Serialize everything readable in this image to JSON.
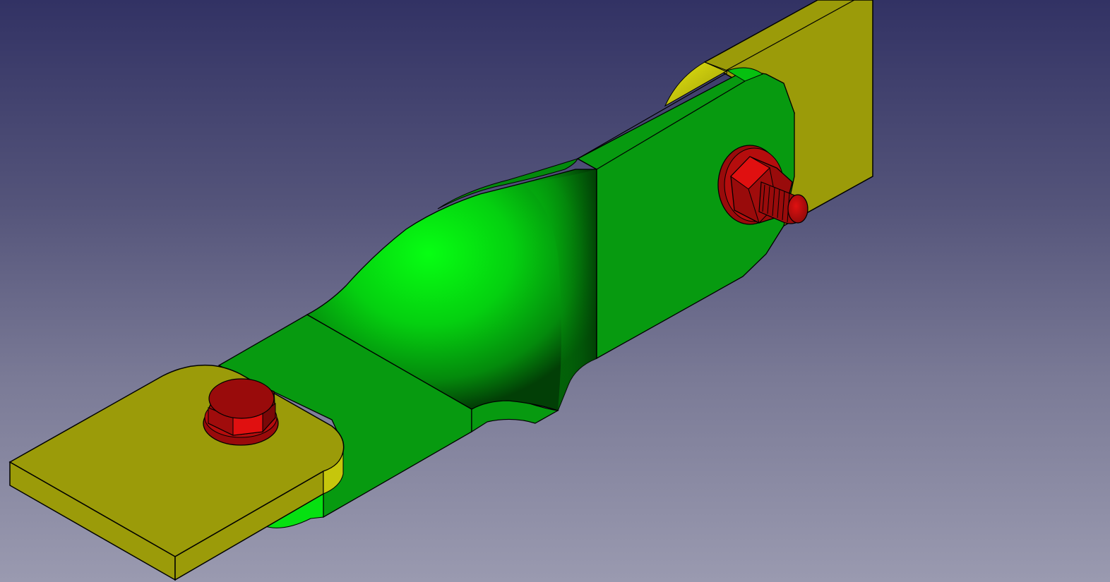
{
  "viewport": {
    "background_top": "#323264",
    "background_bottom": "#9a9ab0"
  },
  "colors": {
    "lug_face": "#9b9b09",
    "lug_highlight": "#d4d40e",
    "bracket_face": "#079a10",
    "bracket_bright": "#06ff12",
    "bracket_dark": "#034f08",
    "bolt_dark": "#990b0b",
    "bolt_bright": "#e01010",
    "edge": "#000000"
  },
  "scene": {
    "parts": [
      {
        "name": "left-lug-plate",
        "color_key": "lug_face"
      },
      {
        "name": "right-lug-plate",
        "color_key": "lug_face"
      },
      {
        "name": "green-bracket",
        "color_key": "bracket_face"
      },
      {
        "name": "left-bolt",
        "color_key": "bolt_dark"
      },
      {
        "name": "right-bolt",
        "color_key": "bolt_dark"
      }
    ]
  }
}
